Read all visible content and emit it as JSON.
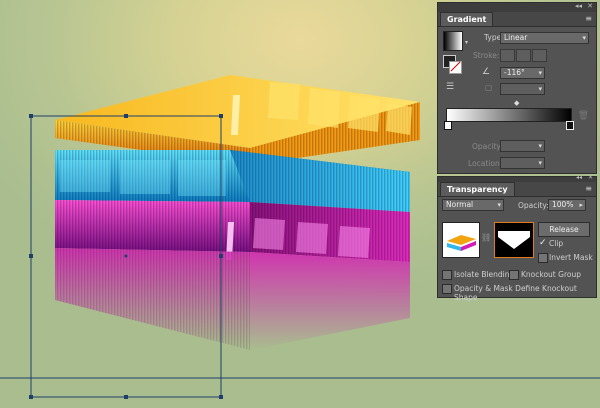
{
  "gradient_panel": {
    "tab": "Gradient",
    "type_label": "Type:",
    "type_value": "Linear",
    "stroke_label": "Stroke:",
    "angle_value": "-116°",
    "opacity_label": "Opacity:",
    "location_label": "Location:"
  },
  "transparency_panel": {
    "tab": "Transparency",
    "blend_mode": "Normal",
    "opacity_label": "Opacity:",
    "opacity_value": "100%",
    "release_button": "Release",
    "clip_label": "Clip",
    "invert_mask_label": "Invert Mask",
    "isolate_blending_label": "Isolate Blending",
    "knockout_group_label": "Knockout Group",
    "define_knockout_label": "Opacity & Mask Define Knockout Shape",
    "clip_checked": true,
    "invert_checked": false,
    "isolate_checked": false,
    "knockout_checked": false,
    "define_knockout_checked": false
  },
  "colors": {
    "panel_bg": "#535353",
    "layer_orange": "#f2a40f",
    "layer_blue": "#2fb8e8",
    "layer_magenta": "#d41cb4",
    "selection_outline": "#1f3f6a"
  }
}
